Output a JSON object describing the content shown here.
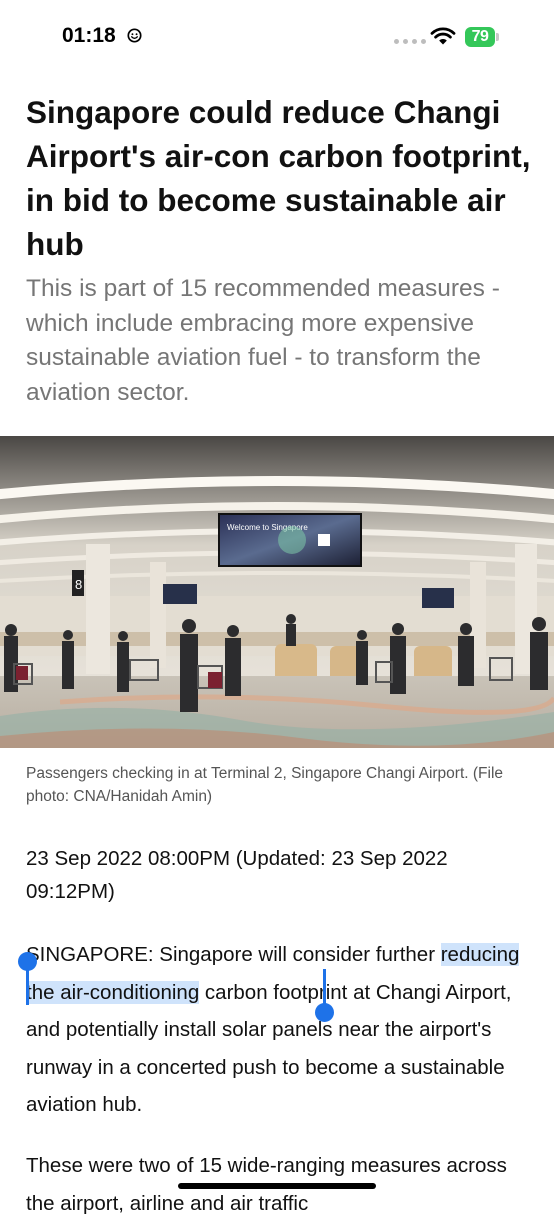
{
  "status_bar": {
    "time": "01:18",
    "battery": "79"
  },
  "article": {
    "headline": "Singapore could reduce Changi Airport's air-con carbon footprint, in bid to become sustainable air hub",
    "subheadline": "This is part of 15 recommended measures - which include embracing more expensive sustainable aviation fuel - to transform the aviation sector.",
    "image": {
      "screen_text": "Welcome to Singapore",
      "counter_sign": "8"
    },
    "caption": "Passengers checking in at Terminal 2, Singapore Changi Airport. (File photo: CNA/Hanidah Amin)",
    "dateline": "23 Sep 2022 08:00PM (Updated: 23 Sep 2022 09:12PM)",
    "paragraph1": {
      "before": "SINGAPORE: Singapore will consider further ",
      "selected": "reducing the air-conditioning",
      "after": " carbon footprint at Changi Airport, and potentially install solar panels near the airport's runway in a concerted push to become a sustainable aviation hub."
    },
    "paragraph2": "These were two of 15 wide-ranging measures across the airport, airline and air traffic"
  },
  "colors": {
    "selection": "#cfe3fb",
    "selection_handle": "#1e72e8",
    "battery": "#34c759",
    "subhead_text": "#767676"
  },
  "icons": [
    "smiley-icon",
    "wifi-icon",
    "battery-icon",
    "signal-dots-icon"
  ]
}
